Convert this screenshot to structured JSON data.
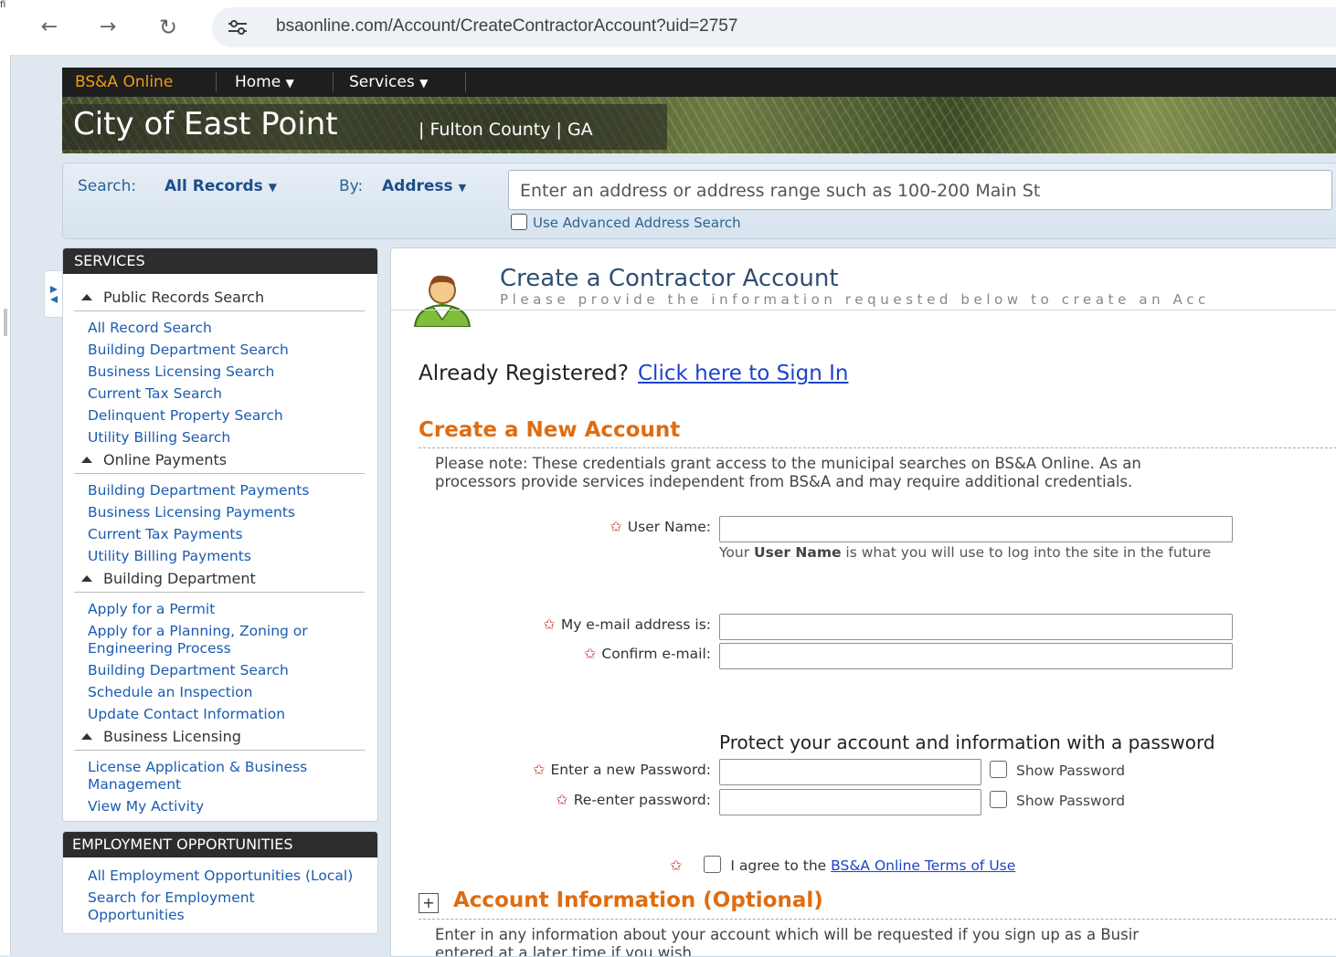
{
  "browser": {
    "url": "bsaonline.com/Account/CreateContractorAccount?uid=2757",
    "corner_glyph": "fi"
  },
  "topnav": {
    "brand": "BS&A Online",
    "items": [
      "Home",
      "Services"
    ]
  },
  "banner": {
    "city": "City of East Point",
    "county": "| Fulton County | GA"
  },
  "search": {
    "search_label": "Search:",
    "search_value": "All Records",
    "by_label": "By:",
    "by_value": "Address",
    "placeholder": "Enter an address or address range such as 100-200 Main St",
    "advanced": "Use Advanced Address Search"
  },
  "sidebar": {
    "services_title": "SERVICES",
    "sections": [
      {
        "title": "Public Records Search",
        "links": [
          "All Record Search",
          "Building Department Search",
          "Business Licensing Search",
          "Current Tax Search",
          "Delinquent Property Search",
          "Utility Billing Search"
        ]
      },
      {
        "title": "Online Payments",
        "links": [
          "Building Department Payments",
          "Business Licensing Payments",
          "Current Tax Payments",
          "Utility Billing Payments"
        ]
      },
      {
        "title": "Building Department",
        "links": [
          "Apply for a Permit",
          "Apply for a Planning, Zoning or Engineering Process",
          "Building Department Search",
          "Schedule an Inspection",
          "Update Contact Information"
        ]
      },
      {
        "title": "Business Licensing",
        "links": [
          "License Application & Business Management",
          "View My Activity"
        ]
      }
    ],
    "employment_title": "EMPLOYMENT OPPORTUNITIES",
    "employment_links": [
      "All Employment Opportunities (Local)",
      "Search for Employment Opportunities"
    ]
  },
  "main": {
    "title": "Create a Contractor Account",
    "subtitle": "Please provide the information requested below to create an Acc",
    "already_text": "Already Registered?",
    "signin_link": "Click here to Sign In",
    "create_title": "Create a New Account",
    "note_line1": "Please note: These credentials grant access to the municipal searches on BS&A Online. As an",
    "note_line2": "processors provide services independent from BS&A and may require additional credentials.",
    "username_label": "User Name:",
    "username_value": "",
    "hint_pre": "Your ",
    "hint_bold": "User Name",
    "hint_post": " is what you will use to log into the site in the future",
    "email_label": "My e-mail address is:",
    "email_value": "",
    "confirm_label": "Confirm e-mail:",
    "confirm_value": "",
    "protect_text": "Protect your account and information with a password",
    "password_label": "Enter a new Password:",
    "reenter_label": "Re-enter password:",
    "show_password": "Show Password",
    "agree_text": "I agree to the",
    "terms_link": "BS&A Online Terms of Use",
    "account_info_title": "Account Information (Optional)",
    "account_note1": "Enter in any information about your account which will be requested if you sign up as a Busir",
    "account_note2": "entered at a later time if you wish."
  },
  "colors": {
    "brand_orange": "#f39c12",
    "section_orange": "#e06c10",
    "link_blue": "#1a5cb0",
    "nav_dark": "#1e1e1e"
  }
}
